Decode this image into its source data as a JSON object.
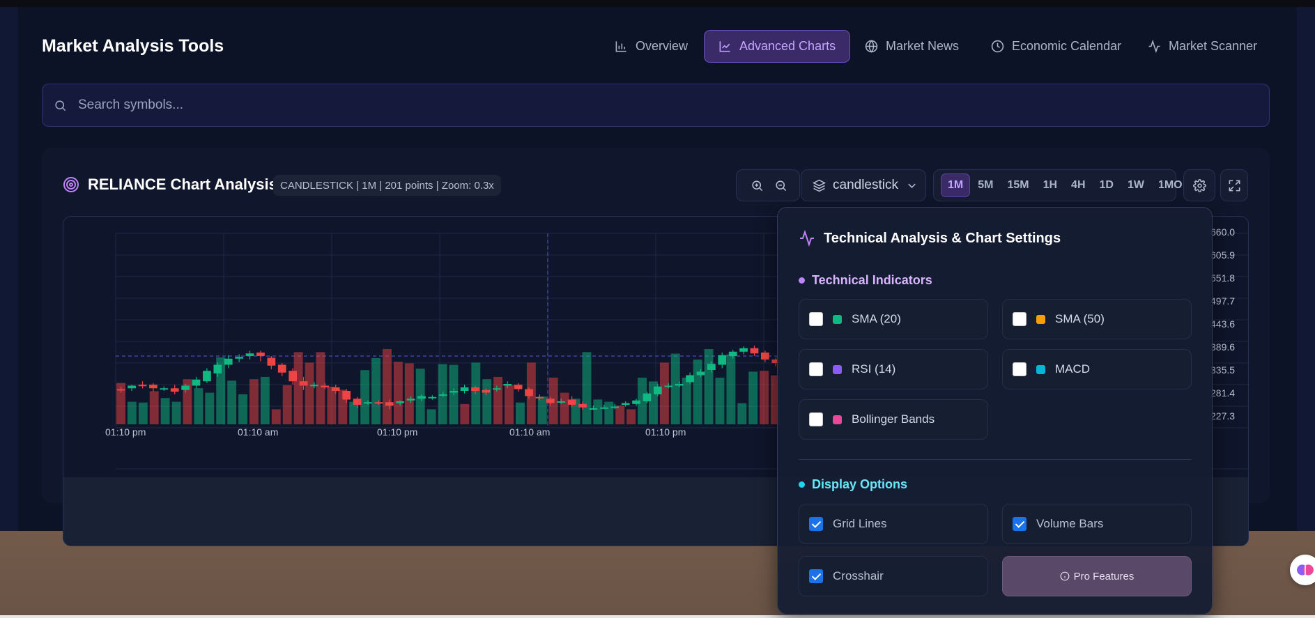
{
  "app": {
    "title": "Market Analysis Tools"
  },
  "nav": [
    {
      "label": "Overview",
      "icon": "bar-chart-icon",
      "active": false
    },
    {
      "label": "Advanced Charts",
      "icon": "line-chart-icon",
      "active": true
    },
    {
      "label": "Market News",
      "icon": "globe-icon",
      "active": false
    },
    {
      "label": "Economic Calendar",
      "icon": "clock-icon",
      "active": false
    },
    {
      "label": "Market Scanner",
      "icon": "activity-icon",
      "active": false
    }
  ],
  "search": {
    "placeholder": "Search symbols..."
  },
  "chart": {
    "title": "RELIANCE Chart Analysis",
    "meta": "CANDLESTICK | 1M | 201 points | Zoom: 0.3x",
    "type_select": "candlestick",
    "timeframes": [
      "1M",
      "5M",
      "15M",
      "1H",
      "4H",
      "1D",
      "1W",
      "1MO"
    ],
    "active_timeframe": "1M",
    "x_tick_labels": [
      "01:10 pm",
      "01:10 am",
      "01:10 pm",
      "01:10 am",
      "01:10 pm"
    ],
    "price_labels": [
      "660.0",
      "605.9",
      "551.8",
      "497.7",
      "443.6",
      "389.6",
      "335.5",
      "281.4",
      "227.3"
    ]
  },
  "settings": {
    "title": "Technical Analysis & Chart Settings",
    "indicators_heading": "Technical Indicators",
    "indicators": [
      {
        "label": "SMA (20)",
        "color": "#10b981",
        "checked": false
      },
      {
        "label": "SMA (50)",
        "color": "#f59e0b",
        "checked": false
      },
      {
        "label": "RSI (14)",
        "color": "#8b5cf6",
        "checked": false
      },
      {
        "label": "MACD",
        "color": "#06b6d4",
        "checked": false
      },
      {
        "label": "Bollinger Bands",
        "color": "#ec4899",
        "checked": false
      }
    ],
    "display_heading": "Display Options",
    "display_options": [
      {
        "label": "Grid Lines",
        "checked": true
      },
      {
        "label": "Volume Bars",
        "checked": true
      },
      {
        "label": "Crosshair",
        "checked": true
      }
    ],
    "pro_button": "Pro Features"
  },
  "colors": {
    "accent": "#c4a6ff",
    "up": "#10b981",
    "down": "#ef4444",
    "indicators_heading": "#d8b4fe",
    "display_heading": "#67e8f9"
  },
  "chart_data": {
    "type": "candlestick",
    "volume": [
      {
        "d": 1,
        "v": 0.55
      },
      {
        "d": 0,
        "v": 0.3
      },
      {
        "d": 0,
        "v": 0.29
      },
      {
        "d": 1,
        "v": 0.44
      },
      {
        "d": 0,
        "v": 0.35
      },
      {
        "d": 0,
        "v": 0.3
      },
      {
        "d": 1,
        "v": 0.6
      },
      {
        "d": 0,
        "v": 0.48
      },
      {
        "d": 0,
        "v": 0.42
      },
      {
        "d": 0,
        "v": 0.89
      },
      {
        "d": 0,
        "v": 0.58
      },
      {
        "d": 0,
        "v": 0.4
      },
      {
        "d": 1,
        "v": 0.6
      },
      {
        "d": 0,
        "v": 0.63
      },
      {
        "d": 1,
        "v": 0.2
      },
      {
        "d": 1,
        "v": 0.52
      },
      {
        "d": 1,
        "v": 0.96
      },
      {
        "d": 1,
        "v": 0.82
      },
      {
        "d": 1,
        "v": 0.96
      },
      {
        "d": 1,
        "v": 0.5
      },
      {
        "d": 1,
        "v": 0.46
      },
      {
        "d": 0,
        "v": 0.3
      },
      {
        "d": 0,
        "v": 0.72
      },
      {
        "d": 0,
        "v": 0.88
      },
      {
        "d": 1,
        "v": 1.0
      },
      {
        "d": 1,
        "v": 0.83
      },
      {
        "d": 1,
        "v": 0.81
      },
      {
        "d": 0,
        "v": 0.74
      },
      {
        "d": 0,
        "v": 0.2
      },
      {
        "d": 0,
        "v": 0.8
      },
      {
        "d": 0,
        "v": 0.79
      },
      {
        "d": 1,
        "v": 0.27
      },
      {
        "d": 0,
        "v": 0.82
      },
      {
        "d": 0,
        "v": 0.6
      },
      {
        "d": 1,
        "v": 0.63
      },
      {
        "d": 1,
        "v": 0.52
      },
      {
        "d": 0,
        "v": 0.29
      },
      {
        "d": 1,
        "v": 0.82
      },
      {
        "d": 0,
        "v": 0.37
      },
      {
        "d": 1,
        "v": 0.62
      },
      {
        "d": 1,
        "v": 0.42
      },
      {
        "d": 0,
        "v": 0.34
      },
      {
        "d": 0,
        "v": 0.96
      },
      {
        "d": 0,
        "v": 0.33
      },
      {
        "d": 0,
        "v": 0.3
      },
      {
        "d": 1,
        "v": 0.25
      },
      {
        "d": 1,
        "v": 0.2
      },
      {
        "d": 0,
        "v": 0.62
      },
      {
        "d": 0,
        "v": 0.57
      },
      {
        "d": 1,
        "v": 0.82
      },
      {
        "d": 0,
        "v": 0.94
      },
      {
        "d": 0,
        "v": 0.62
      },
      {
        "d": 0,
        "v": 0.86
      },
      {
        "d": 0,
        "v": 1.0
      },
      {
        "d": 0,
        "v": 0.62
      },
      {
        "d": 0,
        "v": 0.93
      },
      {
        "d": 0,
        "v": 0.28
      },
      {
        "d": 0,
        "v": 0.7
      },
      {
        "d": 1,
        "v": 0.71
      },
      {
        "d": 1,
        "v": 0.65
      }
    ],
    "candles": [
      {
        "o": 0.26,
        "c": 0.25,
        "h": 0.29,
        "l": 0.22
      },
      {
        "o": 0.27,
        "c": 0.3,
        "h": 0.31,
        "l": 0.24
      },
      {
        "o": 0.31,
        "c": 0.3,
        "h": 0.35,
        "l": 0.27
      },
      {
        "o": 0.31,
        "c": 0.27,
        "h": 0.33,
        "l": 0.23
      },
      {
        "o": 0.26,
        "c": 0.27,
        "h": 0.29,
        "l": 0.24
      },
      {
        "o": 0.27,
        "c": 0.23,
        "h": 0.31,
        "l": 0.2
      },
      {
        "o": 0.25,
        "c": 0.3,
        "h": 0.32,
        "l": 0.22
      },
      {
        "o": 0.3,
        "c": 0.37,
        "h": 0.4,
        "l": 0.27
      },
      {
        "o": 0.35,
        "c": 0.47,
        "h": 0.5,
        "l": 0.33
      },
      {
        "o": 0.44,
        "c": 0.54,
        "h": 0.57,
        "l": 0.4
      },
      {
        "o": 0.54,
        "c": 0.61,
        "h": 0.65,
        "l": 0.5
      },
      {
        "o": 0.61,
        "c": 0.63,
        "h": 0.66,
        "l": 0.57
      },
      {
        "o": 0.64,
        "c": 0.67,
        "h": 0.7,
        "l": 0.6
      },
      {
        "o": 0.68,
        "c": 0.64,
        "h": 0.7,
        "l": 0.58
      },
      {
        "o": 0.62,
        "c": 0.53,
        "h": 0.64,
        "l": 0.49
      },
      {
        "o": 0.54,
        "c": 0.45,
        "h": 0.56,
        "l": 0.41
      },
      {
        "o": 0.47,
        "c": 0.35,
        "h": 0.5,
        "l": 0.31
      },
      {
        "o": 0.35,
        "c": 0.3,
        "h": 0.4,
        "l": 0.25
      },
      {
        "o": 0.31,
        "c": 0.31,
        "h": 0.34,
        "l": 0.27
      },
      {
        "o": 0.3,
        "c": 0.28,
        "h": 0.33,
        "l": 0.26
      },
      {
        "o": 0.28,
        "c": 0.24,
        "h": 0.31,
        "l": 0.21
      },
      {
        "o": 0.24,
        "c": 0.14,
        "h": 0.26,
        "l": 0.1
      },
      {
        "o": 0.15,
        "c": 0.08,
        "h": 0.17,
        "l": 0.04
      },
      {
        "o": 0.1,
        "c": 0.11,
        "h": 0.13,
        "l": 0.08
      },
      {
        "o": 0.11,
        "c": 0.1,
        "h": 0.13,
        "l": 0.08
      },
      {
        "o": 0.11,
        "c": 0.07,
        "h": 0.14,
        "l": 0.03
      },
      {
        "o": 0.1,
        "c": 0.12,
        "h": 0.13,
        "l": 0.07
      },
      {
        "o": 0.13,
        "c": 0.15,
        "h": 0.18,
        "l": 0.1
      },
      {
        "o": 0.15,
        "c": 0.18,
        "h": 0.2,
        "l": 0.12
      },
      {
        "o": 0.17,
        "c": 0.17,
        "h": 0.19,
        "l": 0.14
      },
      {
        "o": 0.2,
        "c": 0.2,
        "h": 0.23,
        "l": 0.17
      },
      {
        "o": 0.22,
        "c": 0.24,
        "h": 0.27,
        "l": 0.19
      },
      {
        "o": 0.24,
        "c": 0.28,
        "h": 0.31,
        "l": 0.21
      },
      {
        "o": 0.28,
        "c": 0.24,
        "h": 0.3,
        "l": 0.2
      },
      {
        "o": 0.25,
        "c": 0.22,
        "h": 0.27,
        "l": 0.19
      },
      {
        "o": 0.26,
        "c": 0.27,
        "h": 0.3,
        "l": 0.23
      },
      {
        "o": 0.3,
        "c": 0.32,
        "h": 0.35,
        "l": 0.27
      },
      {
        "o": 0.31,
        "c": 0.26,
        "h": 0.33,
        "l": 0.23
      },
      {
        "o": 0.26,
        "c": 0.18,
        "h": 0.28,
        "l": 0.15
      },
      {
        "o": 0.17,
        "c": 0.16,
        "h": 0.2,
        "l": 0.13
      },
      {
        "o": 0.15,
        "c": 0.1,
        "h": 0.17,
        "l": 0.07
      },
      {
        "o": 0.12,
        "c": 0.12,
        "h": 0.15,
        "l": 0.09
      },
      {
        "o": 0.14,
        "c": 0.08,
        "h": 0.18,
        "l": 0.05
      },
      {
        "o": 0.09,
        "c": 0.05,
        "h": 0.12,
        "l": 0.02
      },
      {
        "o": 0.04,
        "c": 0.04,
        "h": 0.07,
        "l": 0.02
      },
      {
        "o": 0.05,
        "c": 0.05,
        "h": 0.08,
        "l": 0.03
      },
      {
        "o": 0.05,
        "c": 0.06,
        "h": 0.09,
        "l": 0.03
      },
      {
        "o": 0.08,
        "c": 0.1,
        "h": 0.12,
        "l": 0.06
      },
      {
        "o": 0.09,
        "c": 0.13,
        "h": 0.15,
        "l": 0.07
      },
      {
        "o": 0.12,
        "c": 0.21,
        "h": 0.23,
        "l": 0.1
      },
      {
        "o": 0.2,
        "c": 0.29,
        "h": 0.32,
        "l": 0.18
      },
      {
        "o": 0.29,
        "c": 0.3,
        "h": 0.33,
        "l": 0.27
      },
      {
        "o": 0.3,
        "c": 0.32,
        "h": 0.35,
        "l": 0.28
      },
      {
        "o": 0.34,
        "c": 0.42,
        "h": 0.45,
        "l": 0.32
      },
      {
        "o": 0.42,
        "c": 0.46,
        "h": 0.49,
        "l": 0.4
      },
      {
        "o": 0.48,
        "c": 0.55,
        "h": 0.58,
        "l": 0.45
      },
      {
        "o": 0.54,
        "c": 0.65,
        "h": 0.68,
        "l": 0.5
      },
      {
        "o": 0.64,
        "c": 0.69,
        "h": 0.71,
        "l": 0.61
      },
      {
        "o": 0.69,
        "c": 0.73,
        "h": 0.75,
        "l": 0.66
      },
      {
        "o": 0.73,
        "c": 0.67,
        "h": 0.76,
        "l": 0.64
      },
      {
        "o": 0.68,
        "c": 0.6,
        "h": 0.7,
        "l": 0.57
      },
      {
        "o": 0.6,
        "c": 0.56,
        "h": 0.62,
        "l": 0.52
      }
    ]
  }
}
